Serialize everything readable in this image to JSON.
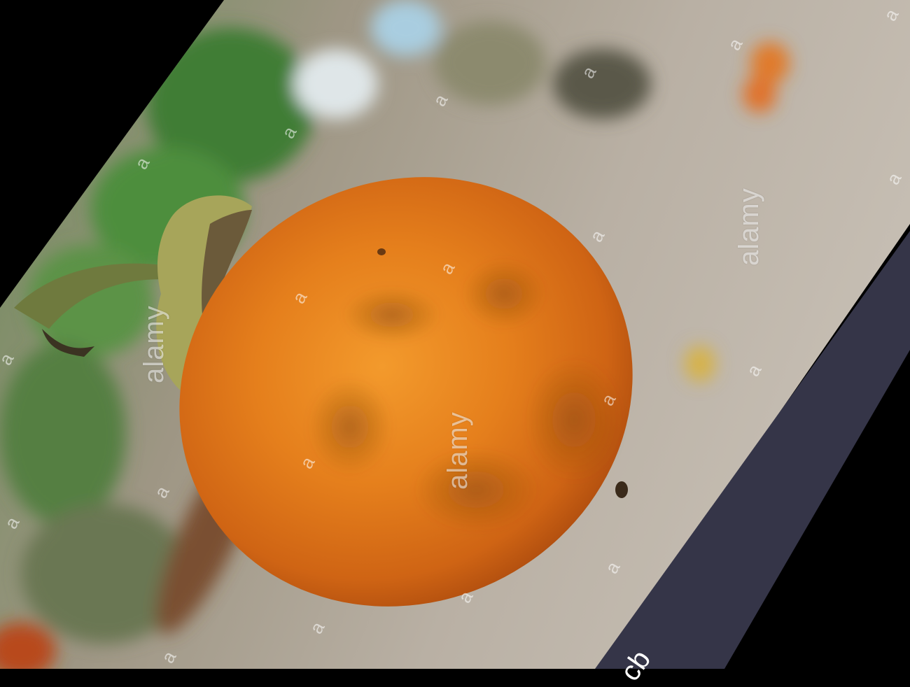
{
  "watermark": {
    "brand": "alamy",
    "glyph": "a"
  },
  "banner": {
    "partial_text": "cb",
    "color": "#353548"
  },
  "colors": {
    "fruit_orange": "#e8801c",
    "background_gravel": "#b3aa9e",
    "foliage_green": "#4f8a3c",
    "border": "#000000"
  }
}
